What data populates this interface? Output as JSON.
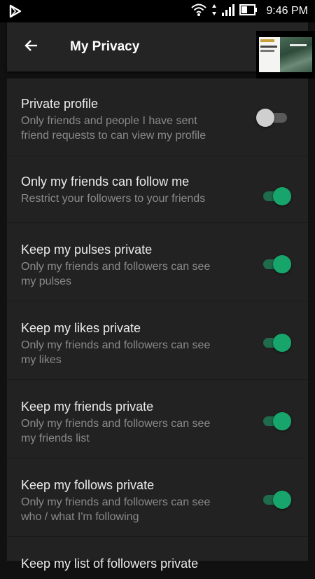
{
  "status_bar": {
    "time": "9:46 PM",
    "icons": [
      "play-store-icon",
      "wifi-icon",
      "data-arrows-icon",
      "signal-icon",
      "battery-icon"
    ]
  },
  "app_bar": {
    "title": "My Privacy",
    "back_icon": "back-arrow-icon"
  },
  "colors": {
    "background": "#222222",
    "toggle_on": "#17a56c",
    "toggle_off": "#cfcfcf"
  },
  "settings": [
    {
      "title": "Private profile",
      "description": "Only friends and people I have sent friend requests to can view my profile",
      "desc_lines": [
        "Only friends and people I have sent",
        "friend requests to can view my profile"
      ],
      "enabled": false
    },
    {
      "title": "Only my friends can follow me",
      "description": "Restrict your followers to your friends",
      "desc_lines": [
        "Restrict your followers to your friends"
      ],
      "enabled": true
    },
    {
      "title": "Keep my pulses private",
      "description": "Only my friends and followers can see my pulses",
      "desc_lines": [
        "Only my friends and followers can see",
        "my pulses"
      ],
      "enabled": true
    },
    {
      "title": "Keep my likes private",
      "description": "Only my friends and followers can see my likes",
      "desc_lines": [
        "Only my friends and followers can see",
        "my likes"
      ],
      "enabled": true
    },
    {
      "title": "Keep my friends private",
      "description": "Only my friends and followers can see my friends list",
      "desc_lines": [
        "Only my friends and followers can see",
        "my friends list"
      ],
      "enabled": true
    },
    {
      "title": "Keep my follows private",
      "description": "Only my friends and followers can see who / what I'm following",
      "desc_lines": [
        "Only my friends and followers can see",
        "who / what I'm following"
      ],
      "enabled": true
    },
    {
      "title": "Keep my list of followers private",
      "description": "",
      "desc_lines": [],
      "enabled": true
    }
  ]
}
